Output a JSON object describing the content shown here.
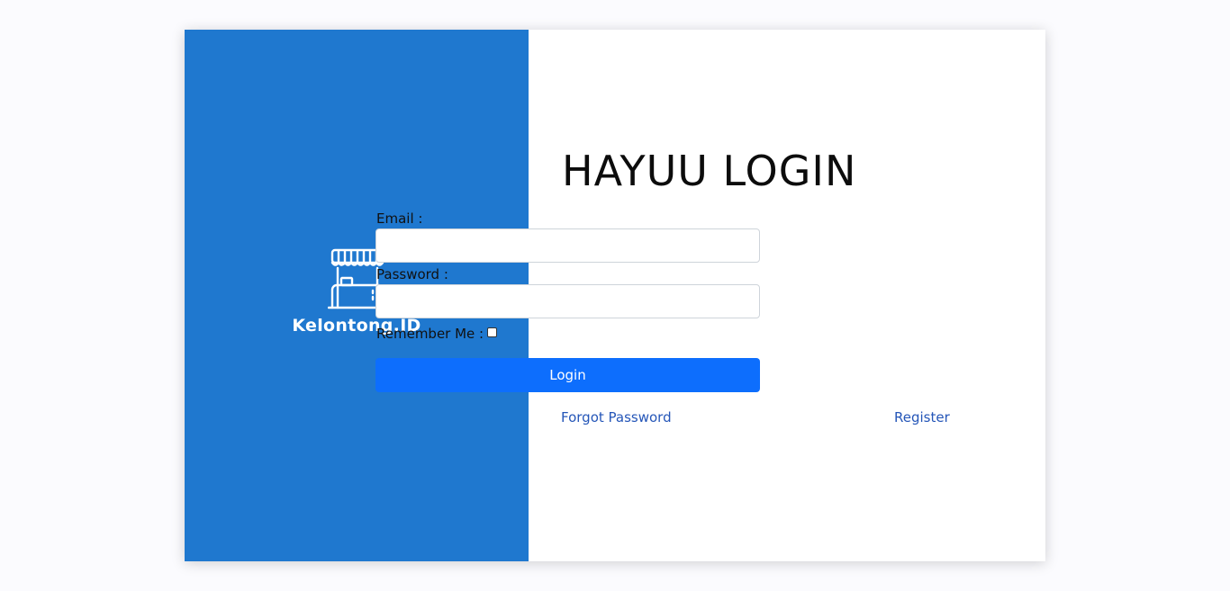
{
  "brand": {
    "name": "Kelontong.ID",
    "logo_icon": "market-stall-icon",
    "panel_color": "#1f78cf"
  },
  "form": {
    "title": "HAYUU LOGIN",
    "email_label": "Email :",
    "email_value": "",
    "password_label": "Password :",
    "password_value": "",
    "remember_label": "Remember Me :",
    "remember_checked": false,
    "login_button": "Login",
    "forgot_password_link": "Forgot Password",
    "register_link": "Register"
  },
  "colors": {
    "primary_button": "#0d6efd",
    "link": "#2556b8",
    "background": "#fbfbfe"
  }
}
